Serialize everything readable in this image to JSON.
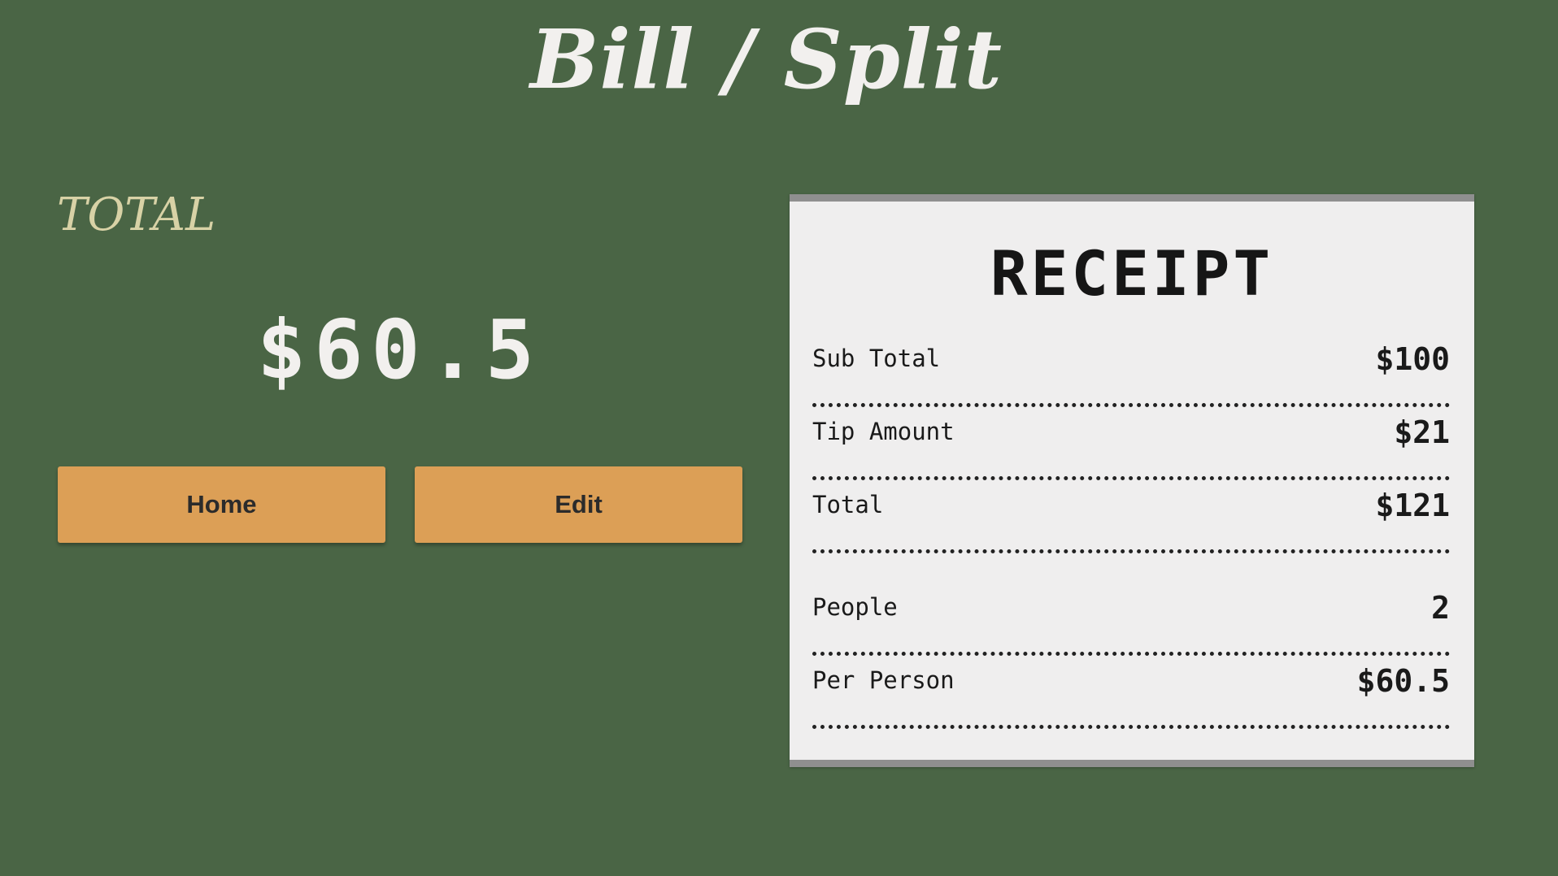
{
  "app": {
    "title": "Bill / Split"
  },
  "summary": {
    "total_label": "TOTAL",
    "total_amount": "$60.5"
  },
  "actions": {
    "home_label": "Home",
    "edit_label": "Edit"
  },
  "receipt": {
    "title": "RECEIPT",
    "rows": [
      {
        "label": "Sub Total",
        "value": "$100"
      },
      {
        "label": "Tip Amount",
        "value": "$21"
      },
      {
        "label": "Total",
        "value": "$121"
      },
      {
        "label": "People",
        "value": "2"
      },
      {
        "label": "Per Person",
        "value": "$60.5"
      }
    ]
  },
  "colors": {
    "background": "#4a6545",
    "button": "#dc9f56",
    "receipt_paper": "#efeeee",
    "total_label": "#d8d2a6"
  }
}
